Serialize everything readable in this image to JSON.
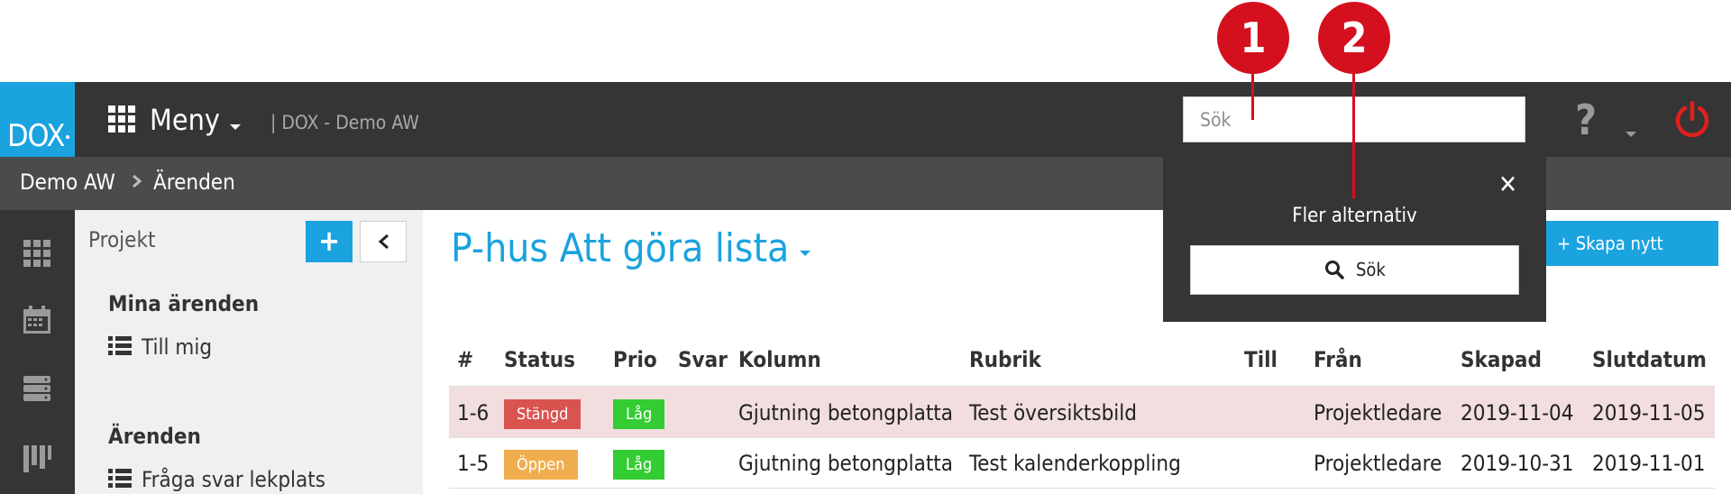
{
  "app": {
    "logo": "DOX",
    "menu_label": "Meny",
    "separator_title": "| DOX - Demo AW"
  },
  "search": {
    "placeholder": "Sök"
  },
  "breadcrumb": {
    "root": "Demo AW",
    "current": "Ärenden"
  },
  "sidebar": {
    "project_label": "Projekt",
    "add_label": "+",
    "section_mine": "Mina ärenden",
    "item_to_me": "Till mig",
    "section_cases": "Ärenden",
    "item_question": "Fråga svar lekplats"
  },
  "main": {
    "title": "P-hus Att göra lista",
    "create_button": "+ Skapa nytt ärende"
  },
  "table": {
    "headers": [
      "#",
      "Status",
      "Prio",
      "Svar",
      "Kolumn",
      "Rubrik",
      "Till",
      "Från",
      "Skapad",
      "Slutdatum"
    ],
    "rows": [
      {
        "id": "1-6",
        "status": "Stängd",
        "prio": "Låg",
        "svar": "",
        "kolumn": "Gjutning betongplatta",
        "rubrik": "Test översiktsbild",
        "till": "",
        "fran": "Projektledare",
        "skapad": "2019-11-04",
        "slutdatum": "2019-11-05"
      },
      {
        "id": "1-5",
        "status": "Öppen",
        "prio": "Låg",
        "svar": "",
        "kolumn": "Gjutning betongplatta",
        "rubrik": "Test kalenderkoppling",
        "till": "",
        "fran": "Projektledare",
        "skapad": "2019-10-31",
        "slutdatum": "2019-11-01"
      }
    ]
  },
  "popover": {
    "close": "✕",
    "text": "Fler alternativ",
    "button_label": "Sök"
  },
  "markers": {
    "one": "1",
    "two": "2"
  },
  "colors": {
    "accent": "#1aa3df",
    "topbar": "#353535",
    "marker": "#d4101f",
    "closed": "#d9534f",
    "open": "#f0ad4e",
    "low": "#33cc33"
  }
}
